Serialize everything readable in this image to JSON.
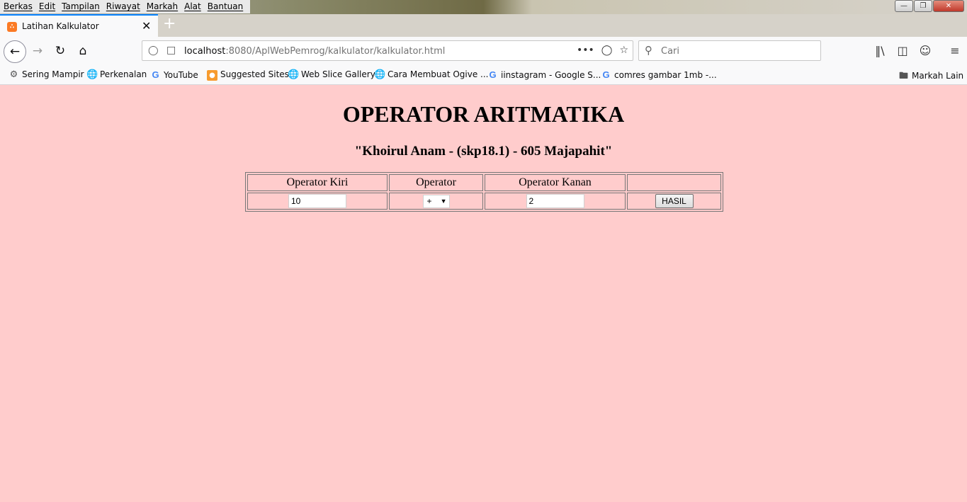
{
  "menubar": {
    "items": [
      "Berkas",
      "Edit",
      "Tampilan",
      "Riwayat",
      "Markah",
      "Alat",
      "Bantuan"
    ]
  },
  "tab": {
    "title": "Latihan Kalkulator"
  },
  "nav": {
    "url_host": "localhost",
    "url_rest": ":8080/AplWebPemrog/kalkulator/kalkulator.html",
    "search_placeholder": "Cari"
  },
  "bookmarks": [
    {
      "label": "Sering Mampir",
      "icon": "gear-icon"
    },
    {
      "label": "Perkenalan",
      "icon": "globe-icon"
    },
    {
      "label": "YouTube",
      "icon": "google-icon"
    },
    {
      "label": "Suggested Sites",
      "icon": "suggested-icon"
    },
    {
      "label": "Web Slice Gallery",
      "icon": "globe-icon"
    },
    {
      "label": "Cara Membuat Ogive ...",
      "icon": "globe-icon"
    },
    {
      "label": "iinstagram - Google S...",
      "icon": "google-icon"
    },
    {
      "label": "comres gambar 1mb -...",
      "icon": "google-icon"
    }
  ],
  "other_bookmarks": "Markah Lain",
  "page": {
    "title": "OPERATOR ARITMATIKA",
    "subtitle": "\"Khoirul Anam - (skp18.1) - 605 Majapahit\"",
    "headers": [
      "Operator Kiri",
      "Operator",
      "Operator Kanan",
      ""
    ],
    "left_value": "10",
    "operator_value": "+",
    "right_value": "2",
    "button_label": "HASIL"
  }
}
